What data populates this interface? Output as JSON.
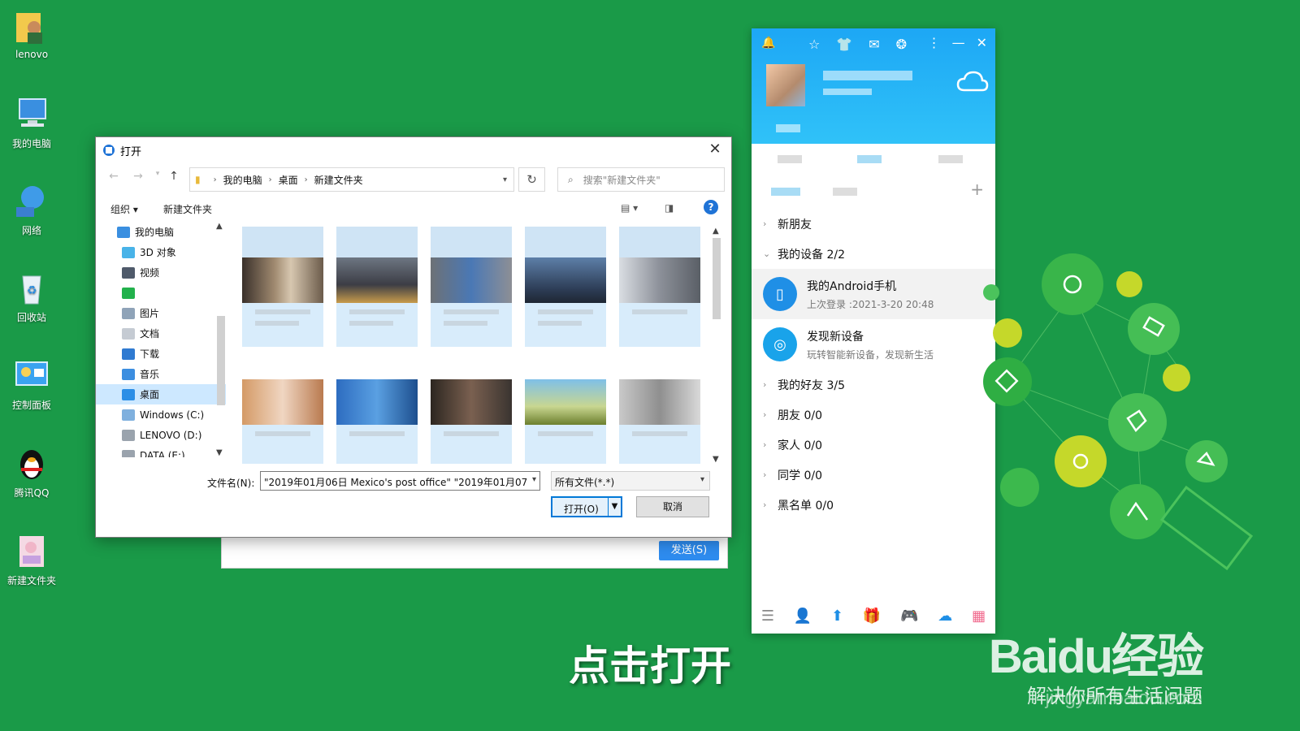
{
  "desktop": {
    "icons": [
      {
        "label": "lenovo"
      },
      {
        "label": "我的电脑"
      },
      {
        "label": "网络"
      },
      {
        "label": "回收站"
      },
      {
        "label": "控制面板"
      },
      {
        "label": "腾讯QQ"
      },
      {
        "label": "新建文件夹"
      }
    ]
  },
  "dialog": {
    "title": "打开",
    "breadcrumb": [
      "我的电脑",
      "桌面",
      "新建文件夹"
    ],
    "search_placeholder": "搜索\"新建文件夹\"",
    "organize": "组织",
    "new_folder": "新建文件夹",
    "tree": [
      {
        "label": "我的电脑"
      },
      {
        "label": "3D 对象"
      },
      {
        "label": "视频"
      },
      {
        "label": ""
      },
      {
        "label": "图片"
      },
      {
        "label": "文档"
      },
      {
        "label": "下载"
      },
      {
        "label": "音乐"
      },
      {
        "label": "桌面"
      },
      {
        "label": "Windows (C:)"
      },
      {
        "label": "LENOVO (D:)"
      },
      {
        "label": "DATA (E:)"
      }
    ],
    "filename_label": "文件名(N):",
    "filename_value": "\"2019年01月06日 Mexico's post office\" \"2019年01月07",
    "filetype_value": "所有文件(*.*)",
    "open_button": "打开(O)",
    "cancel_button": "取消",
    "colors": {
      "accent": "#0078d7",
      "selected": "#cde8ff"
    }
  },
  "chat": {
    "send_button": "发送(S)"
  },
  "qq": {
    "groups": [
      {
        "label": "新朋友"
      },
      {
        "label": "我的设备 2/2"
      }
    ],
    "devices": [
      {
        "name": "我的Android手机",
        "sub": "上次登录 :2021-3-20 20:48"
      },
      {
        "name": "发现新设备",
        "sub": "玩转智能新设备，发现新生活"
      }
    ],
    "groups_after": [
      {
        "label": "我的好友 3/5"
      },
      {
        "label": "朋友 0/0"
      },
      {
        "label": "家人 0/0"
      },
      {
        "label": "同学 0/0"
      },
      {
        "label": "黑名单 0/0"
      }
    ],
    "colors": {
      "header": "#1da7f5"
    }
  },
  "caption": "点击打开",
  "watermark": {
    "brand": "Baidu经验",
    "url": "jingyan.baidu.com",
    "slogan": "解决你所有生活问题"
  }
}
